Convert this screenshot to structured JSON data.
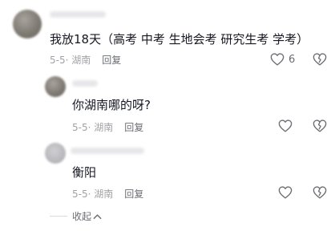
{
  "comment": {
    "text": "我放18天（高考 中考 生地会考 研究生考 学考）",
    "date_location": "5-5· 湖南",
    "reply_label": "回复",
    "like_count": "6"
  },
  "replies": [
    {
      "text": "你湖南哪的呀?",
      "date_location": "5-5· 湖南",
      "reply_label": "回复"
    },
    {
      "text": "衡阳",
      "date_location": "5-5· 湖南",
      "reply_label": "回复"
    }
  ],
  "collapse_label": "收起",
  "icons": {
    "like": "heart-outline-icon",
    "dislike": "broken-heart-icon",
    "collapse": "chevron-up-icon"
  },
  "colors": {
    "text_primary": "#161823",
    "text_meta": "#a0a2a7",
    "icon": "#6b6d73"
  }
}
